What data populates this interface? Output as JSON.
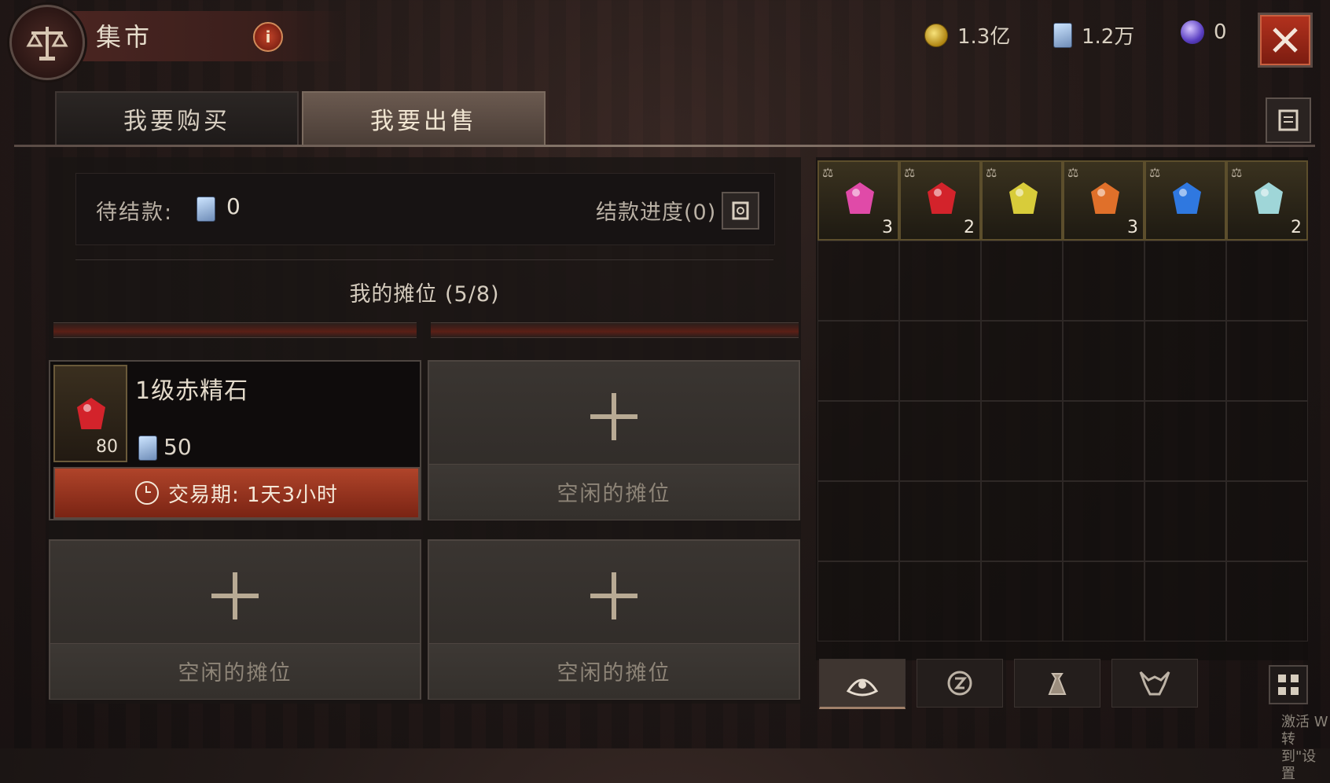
{
  "header": {
    "title": "集市",
    "info_label": "i",
    "currencies": [
      {
        "icon": "gold-coin-icon",
        "value": "1.3亿"
      },
      {
        "icon": "ticket-icon",
        "value": "1.2万"
      },
      {
        "icon": "orb-icon",
        "value": "0"
      }
    ],
    "close_icon": "close-icon"
  },
  "tabs": [
    {
      "label": "我要购买",
      "active": false
    },
    {
      "label": "我要出售",
      "active": true
    }
  ],
  "settlement": {
    "label": "待结款:",
    "value": "0",
    "progress_label": "结款进度(0)"
  },
  "stalls": {
    "title": "我的摊位 (5/8)",
    "listed_item": {
      "name": "1级赤精石",
      "count": "80",
      "price": "50",
      "trade_period": "交易期: 1天3小时"
    },
    "empty_label": "空闲的摊位"
  },
  "inventory": {
    "items": [
      {
        "gem": "pink-gem-icon",
        "color": "#e04aa8",
        "qty": "3"
      },
      {
        "gem": "red-gem-icon",
        "color": "#d3232b",
        "qty": "2"
      },
      {
        "gem": "yellow-gem-icon",
        "color": "#d8cc3a",
        "qty": ""
      },
      {
        "gem": "orange-gem-icon",
        "color": "#e0702a",
        "qty": "3"
      },
      {
        "gem": "blue-gem-icon",
        "color": "#2f78e0",
        "qty": ""
      },
      {
        "gem": "cyan-gem-icon",
        "color": "#9fd6d8",
        "qty": "2"
      }
    ],
    "bottom_tabs": [
      "gem-tab-icon",
      "rune-tab-icon",
      "bag-tab-icon",
      "demon-tab-icon"
    ]
  },
  "watermark": [
    "激活 W",
    "转到\"设置"
  ]
}
